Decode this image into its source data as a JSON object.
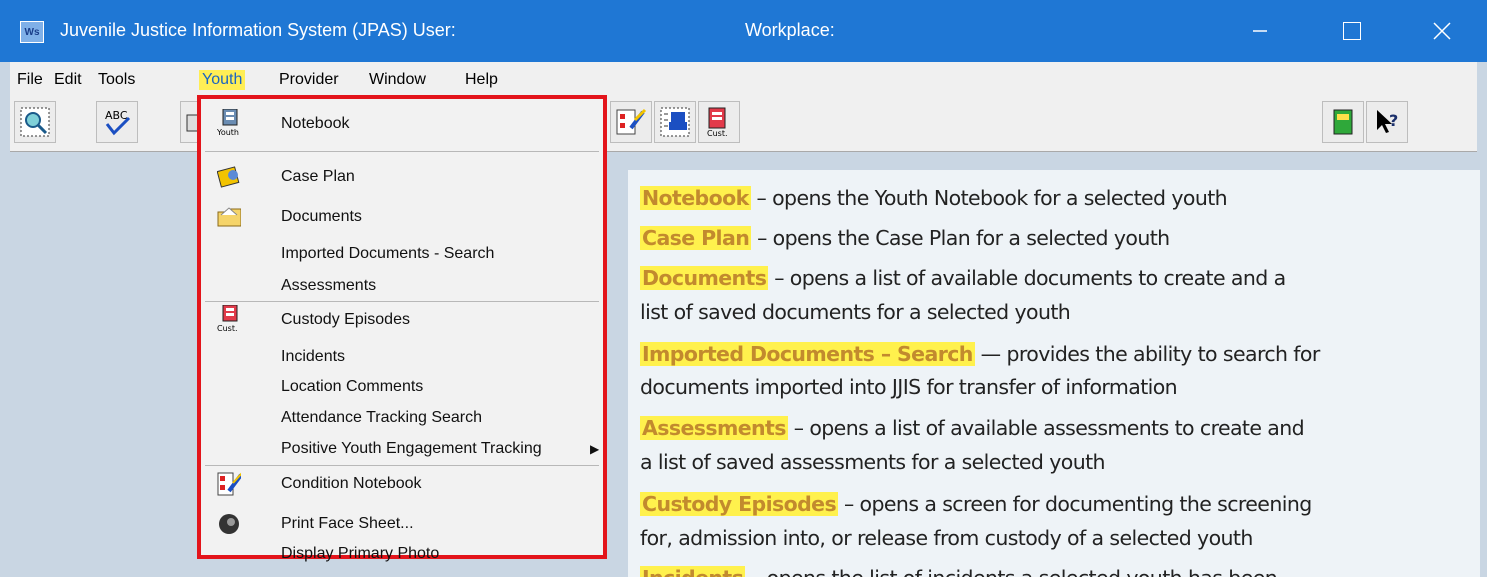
{
  "window": {
    "app_icon_text": "Ws",
    "title": "Juvenile Justice Information System (JPAS)  User:",
    "workplace": "Workplace:"
  },
  "menubar": {
    "items": [
      "File",
      "Edit",
      "Tools",
      "Youth",
      "Provider",
      "Window",
      "Help"
    ]
  },
  "toolbar": {
    "buttons": [
      "search-icon",
      "spell-check-icon",
      "print-icon",
      "condition-notebook-icon",
      "checklist-icon",
      "custody-notebook-icon",
      "notebook-green-icon",
      "help-pointer-icon"
    ],
    "spellcheck_text": "ABC",
    "custody_text": "Cust.",
    "help_text": "?"
  },
  "youth_menu": {
    "items": [
      {
        "label": "Notebook",
        "icon": "youth-notebook-icon",
        "icon_text": "Youth"
      },
      {
        "label": "Case Plan",
        "icon": "case-plan-icon"
      },
      {
        "label": "Documents",
        "icon": "folder-icon"
      },
      {
        "label": "Imported Documents - Search"
      },
      {
        "label": "Assessments"
      },
      {
        "label": "Custody Episodes",
        "icon": "custody-notebook-icon",
        "icon_text": "Cust."
      },
      {
        "label": "Incidents"
      },
      {
        "label": "Location Comments"
      },
      {
        "label": "Attendance Tracking Search"
      },
      {
        "label": "Positive Youth Engagement Tracking",
        "submenu": true
      },
      {
        "label": "Condition Notebook",
        "icon": "condition-notebook-icon"
      },
      {
        "label": "Print Face Sheet...",
        "icon": "face-photo-icon"
      },
      {
        "label": "Display Primary Photo"
      }
    ]
  },
  "descriptions": {
    "notebook_term": "Notebook",
    "notebook_text": " – opens the Youth Notebook for a selected youth",
    "caseplan_term": "Case Plan",
    "caseplan_text": " – opens the Case Plan for a selected youth",
    "documents_term": "Documents",
    "documents_text1": " – opens a list of available documents to create and a",
    "documents_text2": "list of saved documents for a selected youth",
    "imported_term": "Imported Documents – Search",
    "imported_text1": " — provides the ability to search for",
    "imported_text2": "documents imported into JJIS for transfer of information",
    "assessments_term": "Assessments",
    "assessments_text1": " – opens a list of available assessments to create and",
    "assessments_text2": "a list of saved assessments for a selected youth",
    "custody_term": "Custody Episodes",
    "custody_text1": " – opens a screen for documenting the screening",
    "custody_text2": "for, admission into, or release from custody of a selected youth",
    "incidents_term": "Incidents",
    "incidents_text": " – opens the list of incidents a selected youth has been"
  }
}
